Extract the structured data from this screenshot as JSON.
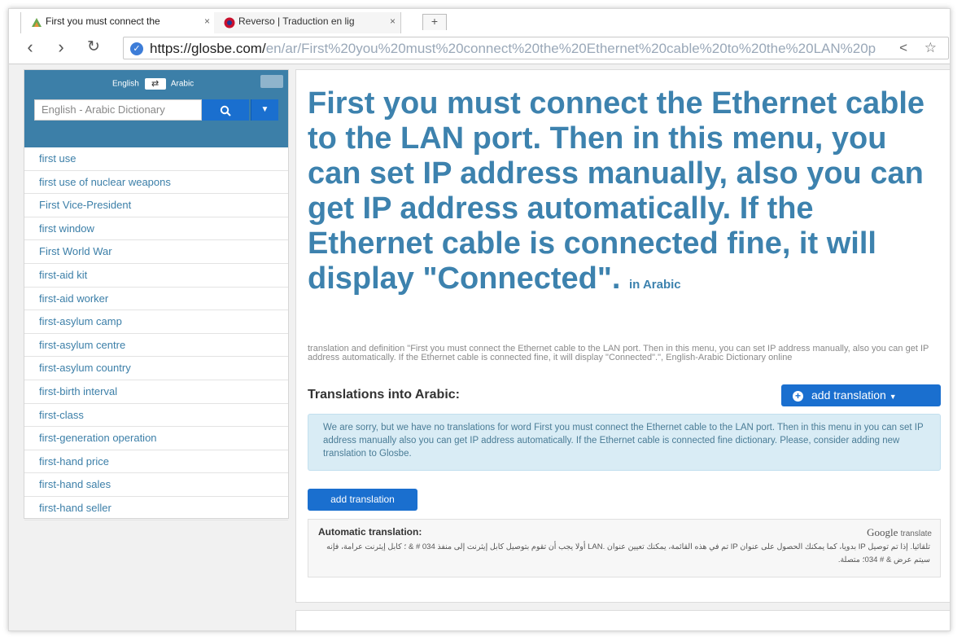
{
  "browser": {
    "tabs": [
      {
        "title": "First you must connect the"
      },
      {
        "title": "Reverso | Traduction en lig"
      }
    ],
    "new_tab": "+",
    "close": "×",
    "url_host": "https://glosbe.com/",
    "url_path": "en/ar/First%20you%20must%20connect%20the%20Ethernet%20cable%20to%20the%20LAN%20p",
    "omni_icons": "< ☆"
  },
  "sidebar": {
    "lang_from": "English",
    "lang_to": "Arabic",
    "search_placeholder": "English - Arabic Dictionary",
    "words": [
      "first use",
      "first use of nuclear weapons",
      "First Vice-President",
      "first window",
      "First World War",
      "first-aid kit",
      "first-aid worker",
      "first-asylum camp",
      "first-asylum centre",
      "first-asylum country",
      "first-birth interval",
      "first-class",
      "first-generation operation",
      "first-hand price",
      "first-hand sales",
      "first-hand seller"
    ]
  },
  "main": {
    "headline": "First you must connect the Ethernet cable to the LAN port. Then in this menu, you can set IP address manually, also you can get IP address automatically. If the Ethernet cable is connected fine, it will display \"Connected\".",
    "in_lang": "in Arabic",
    "definition": "translation and definition \"First you must connect the Ethernet cable to the LAN port. Then in this menu, you can set IP address manually, also you can get IP address automatically. If the Ethernet cable is connected fine, it will display \"Connected\".\", English-Arabic Dictionary  online",
    "translations_title": "Translations into Arabic:",
    "add_translation_dropdown": "add translation",
    "notice": "We are sorry, but we have no translations for word First you must connect the Ethernet cable to the LAN port. Then in this menu in you can set IP address manually also you can get IP address automatically. If the Ethernet cable is connected fine dictionary. Please, consider adding new translation to Glosbe.",
    "add_translation_button": "add translation",
    "auto_label": "Automatic translation:",
    "google": "Google",
    "google_translate": "translate",
    "auto_text": "تلقائيا. إذا تم توصيل IP بدويا، كما يمكنك الحصول على عنوان IP تم في هذه القائمة، يمكنك تعيين عنوان .LAN أولا يجب أن تقوم بتوصيل كابل إيثرنت إلى منفذ 034 # & ؛ كابل إيثرنت عرامة، فإنه سيتم عرض & # 034؛ متصلة."
  }
}
